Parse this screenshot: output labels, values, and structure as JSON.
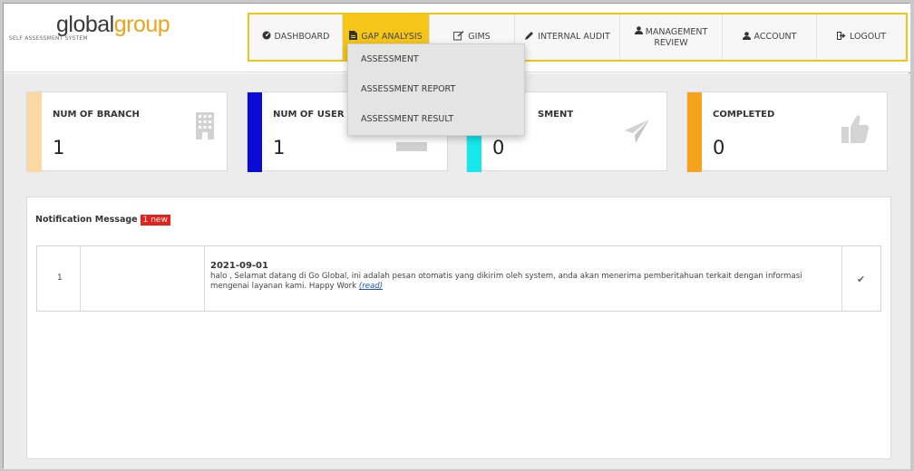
{
  "brand": {
    "logo_part1": "global",
    "logo_part2": "group",
    "subtitle": "SELF ASSESSMENT SYSTEM"
  },
  "nav": {
    "items": [
      {
        "label": "DASHBOARD",
        "icon": "dashboard-icon"
      },
      {
        "label": "GAP ANALYSIS",
        "icon": "file-icon"
      },
      {
        "label": "GIMS",
        "icon": "edit-icon"
      },
      {
        "label": "INTERNAL AUDIT",
        "icon": "pencil-icon"
      },
      {
        "label_line1": "MANAGEMENT",
        "label_line2": "REVIEW",
        "icon": "user-icon"
      },
      {
        "label": "ACCOUNT",
        "icon": "user-icon"
      },
      {
        "label": "LOGOUT",
        "icon": "sign-out-icon"
      }
    ],
    "active": "GAP ANALYSIS",
    "accent": "#f5c518"
  },
  "dropdown": {
    "items": [
      "ASSESSMENT",
      "ASSESSMENT REPORT",
      "ASSESSMENT RESULT"
    ]
  },
  "cards": [
    {
      "title": "NUM OF BRANCH",
      "value": "1",
      "color": "#fcd9a3",
      "icon": "building-icon"
    },
    {
      "title": "NUM OF USER",
      "value": "1",
      "color": "#0b0bd8",
      "icon": "desktop-icon"
    },
    {
      "title": "SMENT",
      "value": "0",
      "color": "#17e8ee",
      "icon": "paper-plane-icon"
    },
    {
      "title": "COMPLETED",
      "value": "0",
      "color": "#f7a21b",
      "icon": "thumbs-up-icon"
    }
  ],
  "notification": {
    "title": "Notification Message",
    "badge": "1 new",
    "rows": [
      {
        "number": "1",
        "date": "2021-09-01",
        "message": "halo , Selamat datang di Go Global, ini adalah pesan otomatis yang dikirim oleh system, anda akan menerima pemberitahuan terkait dengan informasi mengenai layanan kami. Happy Work ",
        "link": "(read)",
        "status": "✔"
      }
    ]
  }
}
